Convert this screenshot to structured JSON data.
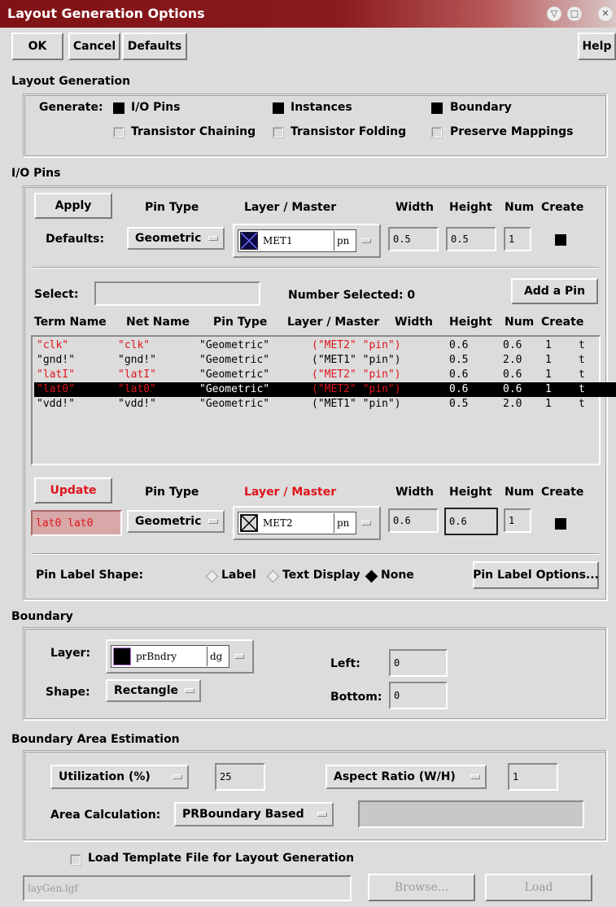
{
  "window": {
    "title": "Layout Generation Options"
  },
  "toolbar": {
    "ok": "OK",
    "cancel": "Cancel",
    "defaults": "Defaults",
    "help": "Help"
  },
  "layout_generation": {
    "heading": "Layout Generation",
    "generate_label": "Generate:",
    "options": [
      {
        "label": "I/O Pins",
        "checked": true
      },
      {
        "label": "Instances",
        "checked": true
      },
      {
        "label": "Boundary",
        "checked": true
      },
      {
        "label": "Transistor Chaining",
        "checked": false
      },
      {
        "label": "Transistor Folding",
        "checked": false
      },
      {
        "label": "Preserve Mappings",
        "checked": false
      }
    ]
  },
  "io_pins": {
    "heading": "I/O Pins",
    "apply": "Apply",
    "defaults_label": "Defaults:",
    "col_pin_type": "Pin Type",
    "col_layer_master": "Layer / Master",
    "col_width": "Width",
    "col_height": "Height",
    "col_num": "Num",
    "col_create": "Create",
    "defaults": {
      "pin_type": "Geometric",
      "layer": "MET1",
      "purpose": "pn",
      "width": "0.5",
      "height": "0.5",
      "num": "1"
    },
    "select_label": "Select:",
    "select_value": "",
    "number_selected": "Number Selected: 0",
    "add_pin": "Add a Pin",
    "table_headers": [
      "Term Name",
      "Net Name",
      "Pin Type",
      "Layer / Master",
      "Width",
      "Height",
      "Num",
      "Create"
    ],
    "rows": [
      {
        "term": "\"clk\"",
        "net": "\"clk\"",
        "type": "\"Geometric\"",
        "layer": "(\"MET2\" \"pin\")",
        "width": "0.6",
        "height": "0.6",
        "num": "1",
        "create": "t",
        "red": true,
        "selected": false
      },
      {
        "term": "\"gnd!\"",
        "net": "\"gnd!\"",
        "type": "\"Geometric\"",
        "layer": "(\"MET1\" \"pin\")",
        "width": "0.5",
        "height": "2.0",
        "num": "1",
        "create": "t",
        "red": false,
        "selected": false
      },
      {
        "term": "\"latI\"",
        "net": "\"latI\"",
        "type": "\"Geometric\"",
        "layer": "(\"MET2\" \"pin\")",
        "width": "0.6",
        "height": "0.6",
        "num": "1",
        "create": "t",
        "red": true,
        "selected": false
      },
      {
        "term": "\"lat0\"",
        "net": "\"lat0\"",
        "type": "\"Geometric\"",
        "layer": "(\"MET2\" \"pin\")",
        "width": "0.6",
        "height": "0.6",
        "num": "1",
        "create": "t",
        "red": true,
        "selected": true
      },
      {
        "term": "\"vdd!\"",
        "net": "\"vdd!\"",
        "type": "\"Geometric\"",
        "layer": "(\"MET1\" \"pin\")",
        "width": "0.5",
        "height": "2.0",
        "num": "1",
        "create": "t",
        "red": false,
        "selected": false
      }
    ],
    "update": "Update",
    "update_fields": {
      "names": "lat0 lat0",
      "pin_type": "Geometric",
      "layer": "MET2",
      "purpose": "pn",
      "width": "0.6",
      "height": "0.6",
      "num": "1"
    },
    "label_shape_label": "Pin Label Shape:",
    "label_shape_options": [
      {
        "label": "Label",
        "selected": false
      },
      {
        "label": "Text Display",
        "selected": false
      },
      {
        "label": "None",
        "selected": true
      }
    ],
    "label_options_button": "Pin Label Options..."
  },
  "boundary": {
    "heading": "Boundary",
    "layer_label": "Layer:",
    "layer": "prBndry",
    "purpose": "dg",
    "shape_label": "Shape:",
    "shape": "Rectangle",
    "left_label": "Left:",
    "left": "0",
    "bottom_label": "Bottom:",
    "bottom": "0"
  },
  "estimation": {
    "heading": "Boundary Area Estimation",
    "utilization_label": "Utilization (%)",
    "utilization": "25",
    "aspect_label": "Aspect Ratio (W/H)",
    "aspect": "1",
    "area_label": "Area Calculation:",
    "area_mode": "PRBoundary Based",
    "area_value": ""
  },
  "template": {
    "label": "Load Template File for Layout Generation",
    "checked": false,
    "file": "layGen.lgf",
    "browse": "Browse...",
    "load": "Load"
  },
  "colors": {
    "title_bar": "#7f1216",
    "accent_red": "#e0141c",
    "background": "#dcdcdc"
  }
}
